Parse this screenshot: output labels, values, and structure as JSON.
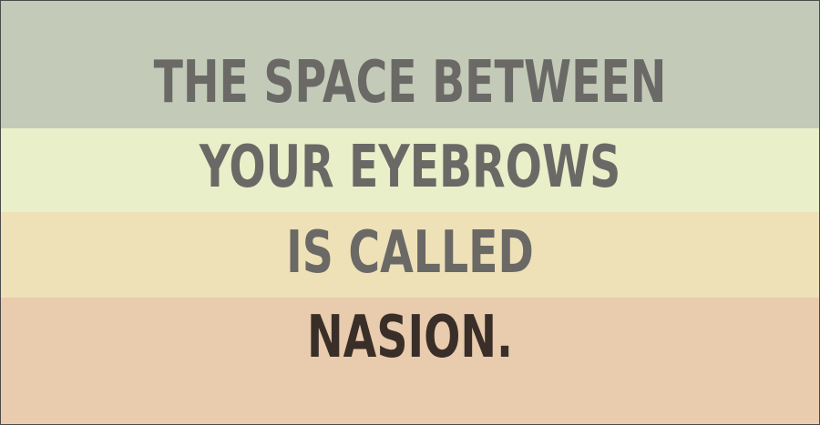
{
  "bands": [
    {
      "color": "#c3cbb8"
    },
    {
      "color": "#e9efc9"
    },
    {
      "color": "#eee1b8"
    },
    {
      "color": "#e9cbae"
    }
  ],
  "lines": [
    {
      "text": "THE SPACE BETWEEN",
      "color": "#6b6966"
    },
    {
      "text": "YOUR EYEBROWS",
      "color": "#6b6966"
    },
    {
      "text": "IS CALLED",
      "color": "#6b6966"
    },
    {
      "text": "NASION.",
      "color": "#3a2f28"
    }
  ]
}
